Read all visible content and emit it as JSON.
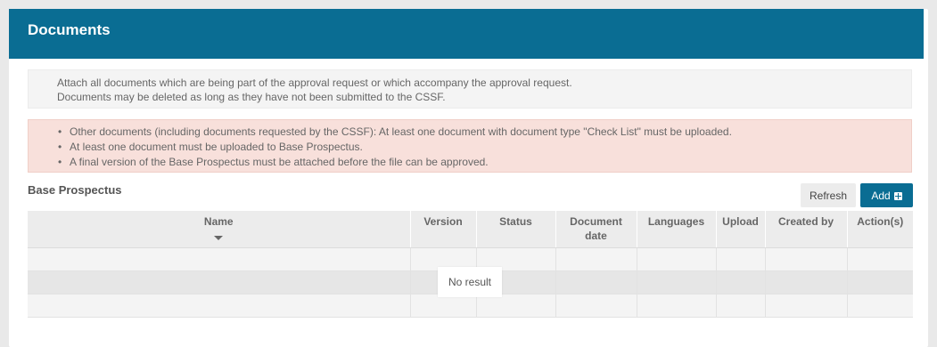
{
  "panel": {
    "title": "Documents"
  },
  "info": {
    "line1": "Attach all documents which are being part of the approval request or which accompany the approval request.",
    "line2": "Documents may be deleted as long as they have not been submitted to the CSSF."
  },
  "warnings": [
    "Other documents (including documents requested by the CSSF): At least one document with document type \"Check List\" must be uploaded.",
    "At least one document must be uploaded to Base Prospectus.",
    "A final version of the Base Prospectus must be attached before the file can be approved."
  ],
  "section": {
    "title": "Base Prospectus",
    "refresh_label": "Refresh",
    "add_label": "Add"
  },
  "table": {
    "columns": [
      "Name",
      "Version",
      "Status",
      "Document date",
      "Languages",
      "Upload",
      "Created by",
      "Action(s)"
    ],
    "empty_message": "No result"
  },
  "colors": {
    "header_bg": "#0a6d93",
    "warning_bg": "#f8e0db",
    "info_bg": "#f4f4f4",
    "primary_button": "#0a6d93"
  }
}
